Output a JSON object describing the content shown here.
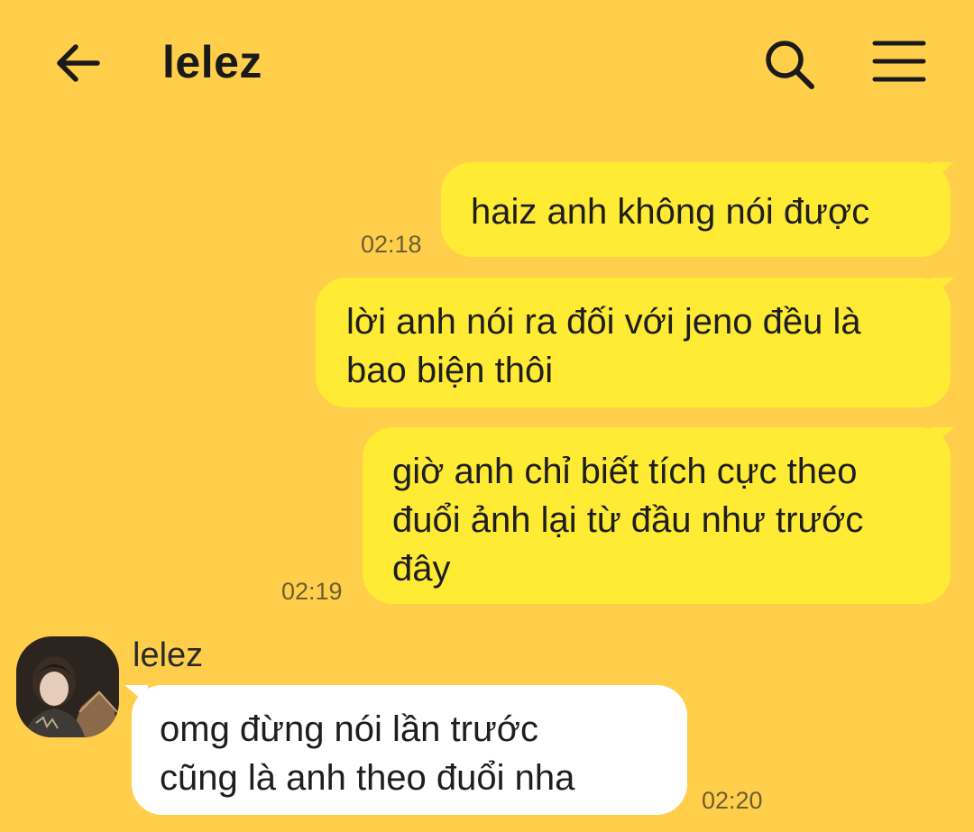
{
  "header": {
    "title": "lelez",
    "back_icon": "arrow-left-icon",
    "search_icon": "search-icon",
    "menu_icon": "hamburger-menu-icon"
  },
  "colors": {
    "background": "#FFCF4C",
    "outgoing_bubble": "#FFEB33",
    "incoming_bubble": "#FFFFFF"
  },
  "messages": [
    {
      "direction": "outgoing",
      "lines": [
        "haiz anh không nói được"
      ],
      "time": "02:18"
    },
    {
      "direction": "outgoing",
      "lines": [
        "lời anh nói ra đối với jeno đều là",
        "bao biện thôi"
      ],
      "time": ""
    },
    {
      "direction": "outgoing",
      "lines": [
        "giờ anh chỉ biết tích cực theo",
        "đuổi ảnh lại từ đầu như trước",
        "đây"
      ],
      "time": "02:19"
    },
    {
      "direction": "incoming",
      "sender": "lelez",
      "avatar": "profile-photo",
      "lines": [
        "omg đừng nói lần trước",
        "cũng là anh theo đuổi nha"
      ],
      "time": "02:20"
    }
  ]
}
